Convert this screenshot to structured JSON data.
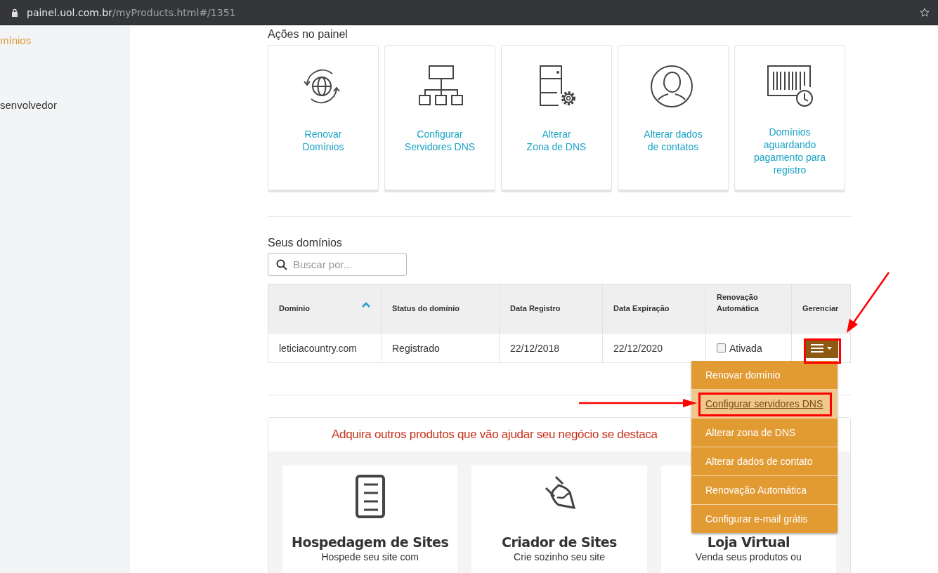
{
  "address_bar": {
    "host": "painel.uol.com.br",
    "path": "/myProducts.html#/1351"
  },
  "sidebar": {
    "items": [
      {
        "label": "mínios",
        "selected": true
      },
      {
        "label": "senvolvedor",
        "selected": false
      }
    ]
  },
  "actions": {
    "title": "Ações no painel",
    "cards": [
      {
        "label": "Renovar\nDomínios"
      },
      {
        "label": "Configurar\nServidores DNS"
      },
      {
        "label": "Alterar\nZona de DNS"
      },
      {
        "label": "Alterar dados\nde contatos"
      },
      {
        "label": "Domínios\naguardando\npagamento para\nregistro"
      }
    ]
  },
  "domains": {
    "title": "Seus domínios",
    "search": {
      "placeholder": "Buscar por..."
    },
    "columns": [
      {
        "label": "Domínio",
        "sorted": true
      },
      {
        "label": "Status do domínio",
        "sorted": false
      },
      {
        "label": "Data Registro",
        "sorted": false
      },
      {
        "label": "Data Expiração",
        "sorted": false
      },
      {
        "label": "Renovação\nAutomática",
        "sorted": false
      },
      {
        "label": "Gerenciar",
        "sorted": false
      }
    ],
    "rows": [
      {
        "domain": "leticiacountry.com",
        "status": "Registrado",
        "registered": "22/12/2018",
        "expires": "22/12/2020",
        "auto_renew": {
          "label": "Ativada",
          "checked": false
        }
      }
    ]
  },
  "manage_menu": {
    "items": [
      {
        "label": "Renovar domínio",
        "selected": false
      },
      {
        "label": "Configurar servidores DNS",
        "selected": true
      },
      {
        "label": "Alterar zona de DNS",
        "selected": false
      },
      {
        "label": "Alterar dados de contato",
        "selected": false
      },
      {
        "label": "Renovação Automática",
        "selected": false
      },
      {
        "label": "Configurar e-mail grátis",
        "selected": false
      }
    ]
  },
  "promo": {
    "title": "Adquira outros produtos que vão ajudar seu negócio se destaca",
    "products": [
      {
        "name": "Hospedagem de Sites",
        "description": "Hospede seu site com"
      },
      {
        "name": "Criador de Sites",
        "description": "Crie sozinho seu site"
      },
      {
        "name": "Loja Virtual",
        "description": "Venda seus produtos ou"
      }
    ]
  }
}
